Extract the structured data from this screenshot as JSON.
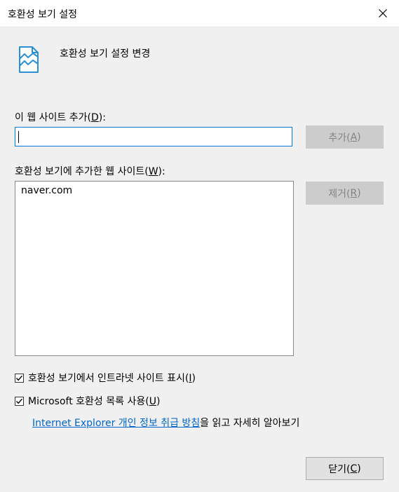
{
  "window": {
    "title": "호환성 보기 설정",
    "close_icon": "close-icon"
  },
  "header": {
    "icon": "broken-page-icon",
    "text": "호환성 보기 설정 변경"
  },
  "add_site": {
    "label_prefix": "이 웹 사이트 추가(",
    "label_key": "D",
    "label_suffix": "):",
    "input_value": "",
    "button_prefix": "추가(",
    "button_key": "A",
    "button_suffix": ")"
  },
  "sites_list": {
    "label_prefix": "호환성 보기에 추가한 웹 사이트(",
    "label_key": "W",
    "label_suffix": "):",
    "items": [
      "naver.com"
    ],
    "remove_prefix": "제거(",
    "remove_key": "R",
    "remove_suffix": ")"
  },
  "options": {
    "intranet": {
      "label_prefix": "호환성 보기에서 인트라넷 사이트 표시(",
      "label_key": "I",
      "label_suffix": ")",
      "checked": true
    },
    "microsoft_list": {
      "label_prefix": "Microsoft 호환성 목록 사용(",
      "label_key": "U",
      "label_suffix": ")",
      "checked": true
    }
  },
  "privacy": {
    "link_text": "Internet Explorer 개인 정보 취급 방침",
    "suffix": "을 읽고 자세히 알아보기"
  },
  "footer": {
    "close_prefix": "닫기(",
    "close_key": "C",
    "close_suffix": ")"
  },
  "colors": {
    "link": "#0066cc",
    "focus_border": "#0078d7",
    "icon": "#2b8fd6"
  }
}
